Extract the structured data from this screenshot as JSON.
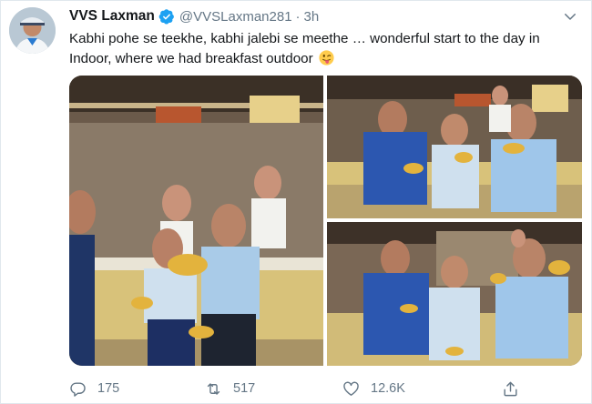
{
  "tweet": {
    "author_name": "VVS Laxman",
    "author_handle": "@VVSLaxman281",
    "separator": "·",
    "timestamp": "3h",
    "text": "Kabhi pohe se teekhe, kabhi jalebi se meethe … wonderful start to the day in Indoor, where we had breakfast outdoor",
    "emoji": "tongue-out-face",
    "media_count": 3
  },
  "actions": {
    "reply_count": "175",
    "retweet_count": "517",
    "like_count": "12.6K"
  },
  "colors": {
    "verified": "#1da1f2",
    "secondary_text": "#657786",
    "border": "#e1e8ed",
    "emoji": "#ffcc4d"
  },
  "icons": {
    "verified": "verified-badge-icon",
    "caret": "chevron-down-icon",
    "reply": "reply-icon",
    "retweet": "retweet-icon",
    "like": "heart-icon",
    "share": "share-icon"
  }
}
